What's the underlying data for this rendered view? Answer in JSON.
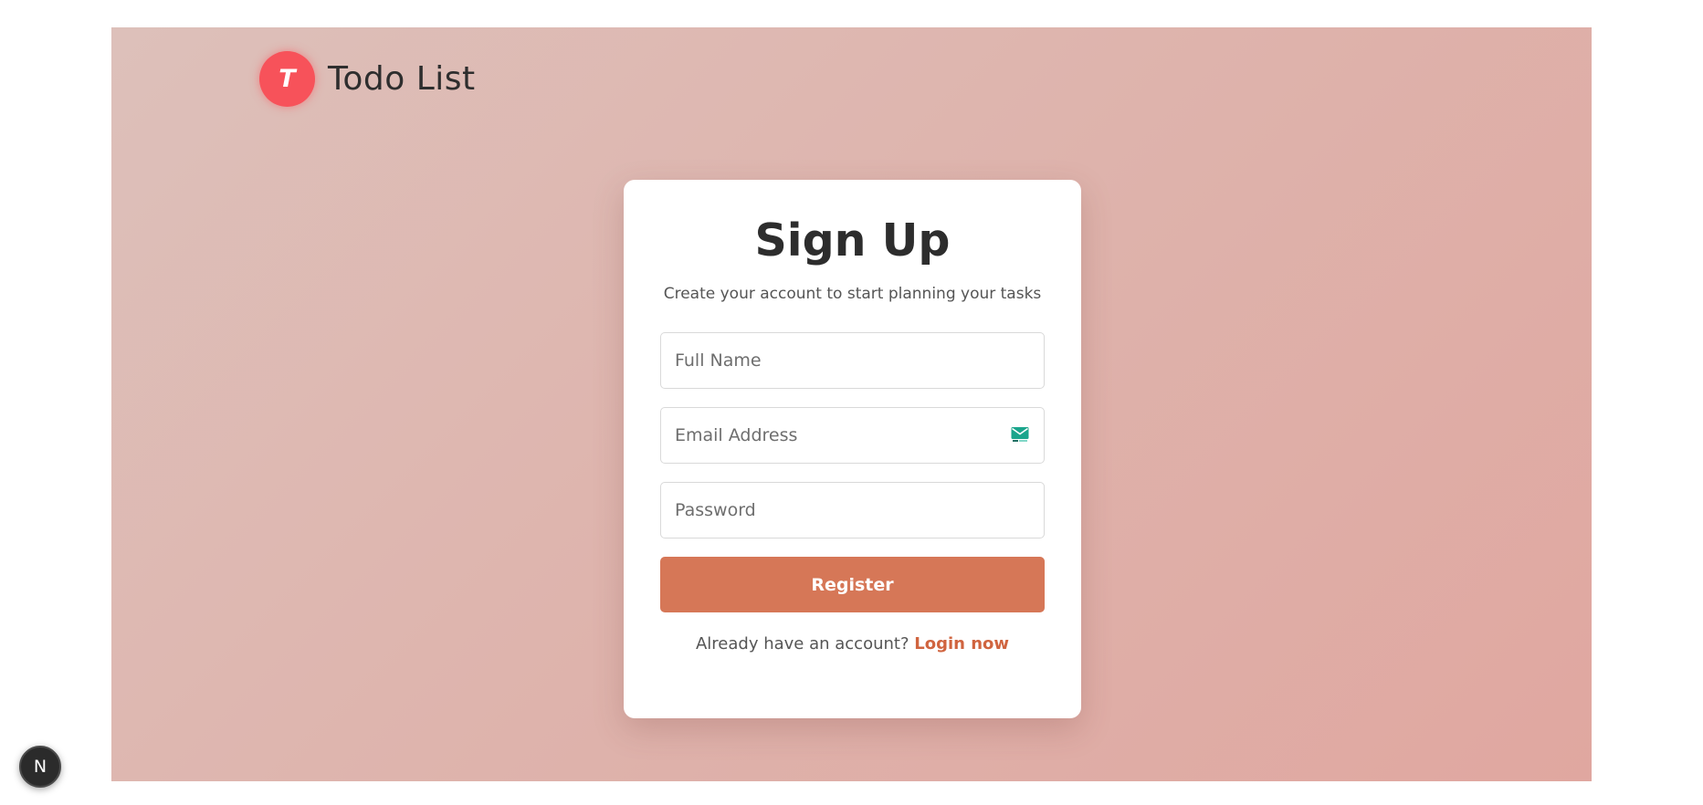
{
  "header": {
    "logo_letter": "T",
    "app_title": "Todo List"
  },
  "signup": {
    "title": "Sign Up",
    "subtitle": "Create your account to start planning your tasks",
    "full_name": {
      "placeholder": "Full Name",
      "value": ""
    },
    "email": {
      "placeholder": "Email Address",
      "value": "",
      "icon": "mail-icon"
    },
    "password": {
      "placeholder": "Password",
      "value": ""
    },
    "register_label": "Register",
    "login_prompt": "Already have an account?",
    "login_link": "Login now"
  },
  "dev_badge": {
    "letter": "N",
    "icon": "nextjs-icon"
  },
  "colors": {
    "accent": "#d67757",
    "link": "#d0643f",
    "logo": "#f7525a",
    "background_start": "#ddc0ba",
    "background_end": "#e0a7a0"
  }
}
